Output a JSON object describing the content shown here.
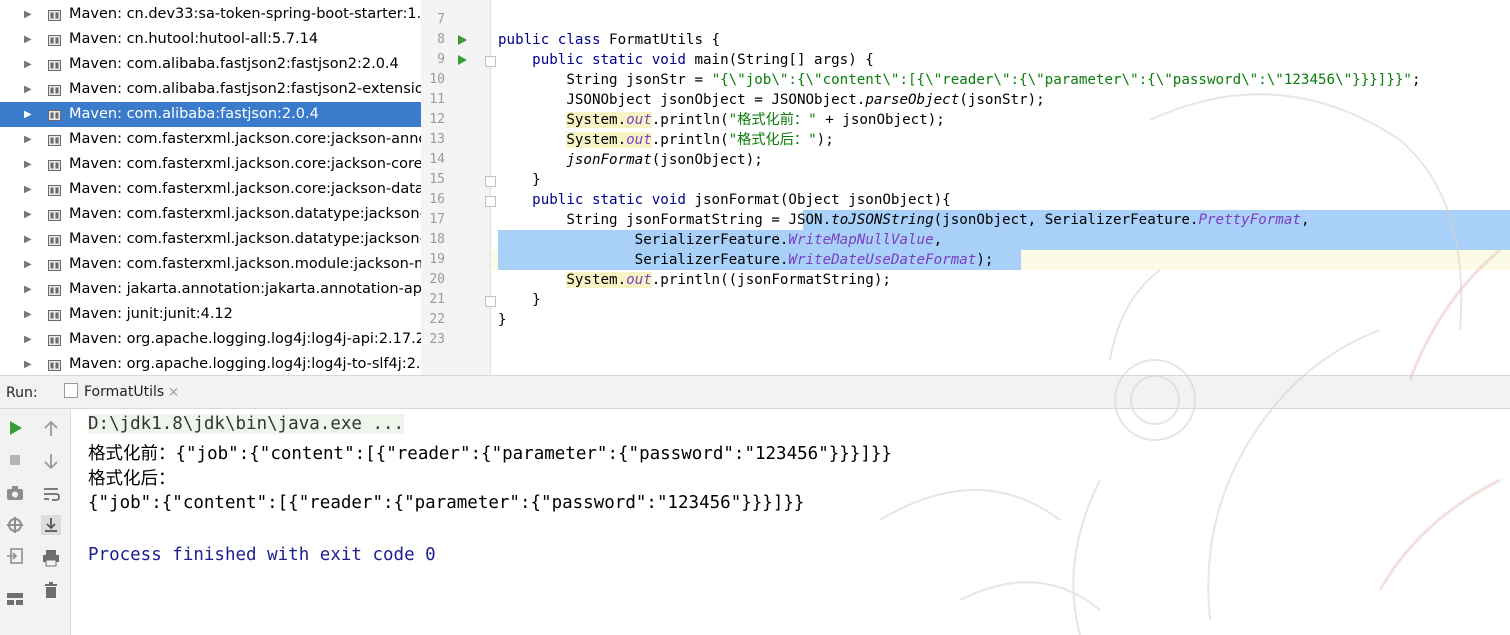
{
  "project_tree": {
    "items": [
      {
        "label": "Maven: cn.dev33:sa-token-spring-boot-starter:1.",
        "selected": false
      },
      {
        "label": "Maven: cn.hutool:hutool-all:5.7.14",
        "selected": false
      },
      {
        "label": "Maven: com.alibaba.fastjson2:fastjson2:2.0.4",
        "selected": false
      },
      {
        "label": "Maven: com.alibaba.fastjson2:fastjson2-extensio",
        "selected": false
      },
      {
        "label": "Maven: com.alibaba:fastjson:2.0.4",
        "selected": true
      },
      {
        "label": "Maven: com.fasterxml.jackson.core:jackson-anno",
        "selected": false
      },
      {
        "label": "Maven: com.fasterxml.jackson.core:jackson-core",
        "selected": false
      },
      {
        "label": "Maven: com.fasterxml.jackson.core:jackson-data",
        "selected": false
      },
      {
        "label": "Maven: com.fasterxml.jackson.datatype:jackson-",
        "selected": false
      },
      {
        "label": "Maven: com.fasterxml.jackson.datatype:jackson-",
        "selected": false
      },
      {
        "label": "Maven: com.fasterxml.jackson.module:jackson-m",
        "selected": false
      },
      {
        "label": "Maven: jakarta.annotation:jakarta.annotation-api",
        "selected": false
      },
      {
        "label": "Maven: junit:junit:4.12",
        "selected": false
      },
      {
        "label": "Maven: org.apache.logging.log4j:log4j-api:2.17.2",
        "selected": false
      },
      {
        "label": "Maven: org.apache.logging.log4j:log4j-to-slf4j:2.",
        "selected": false
      }
    ]
  },
  "editor": {
    "line_numbers": [
      "7",
      "8",
      "9",
      "10",
      "11",
      "12",
      "13",
      "14",
      "15",
      "16",
      "17",
      "18",
      "19",
      "20",
      "21",
      "22",
      "23"
    ],
    "tokens": {
      "l8_kw": "public class ",
      "l8_rest": "FormatUtils {",
      "l9_kw1": "public static void ",
      "l9_rest": "main(String[] args) {",
      "l10_a": "String jsonStr = ",
      "l10_str": "\"{\\\"job\\\":{\\\"content\\\":[{\\\"reader\\\":{\\\"parameter\\\":{\\\"password\\\":\\\"123456\\\"}}}]}}\"",
      "l10_end": ";",
      "l11_a": "JSONObject jsonObject = JSONObject.",
      "l11_m": "parseObject",
      "l11_b": "(jsonStr);",
      "sys": "System.",
      "out": "out",
      "println_open": ".println(",
      "l12_str": "\"格式化前：\"",
      "l12_b": " + jsonObject);",
      "l13_str": "\"格式化后：\"",
      "l13_b": ");",
      "l14_m": "jsonFormat",
      "l14_b": "(jsonObject);",
      "close_brace": "}",
      "l16_kw": "public static void ",
      "l16_rest": "jsonFormat(Object jsonObject){",
      "l17_a": "String jsonFormatString = ",
      "l17_b": "JSON.",
      "l17_m": "toJSONString",
      "l17_c": "(jsonObject, SerializerFeature.",
      "l17_f": "PrettyFormat",
      "l17_d": ",",
      "feature_prefix": "SerializerFeature.",
      "l18_f": "WriteMapNullValue",
      "l18_d": ",",
      "l19_f": "WriteDateUseDateFormat",
      "l19_d": ");",
      "l20_b": "(jsonFormatString);"
    }
  },
  "run_panel": {
    "title": "Run:",
    "tab_label": "FormatUtils",
    "tab_close": "×"
  },
  "console": {
    "lines": [
      "D:\\jdk1.8\\jdk\\bin\\java.exe ...",
      "格式化前：{\"job\":{\"content\":[{\"reader\":{\"parameter\":{\"password\":\"123456\"}}}]}}",
      "格式化后：",
      "{\"job\":{\"content\":[{\"reader\":{\"parameter\":{\"password\":\"123456\"}}}]}}",
      "",
      "Process finished with exit code 0"
    ]
  },
  "colors": {
    "selection": "#3a7ccb",
    "keyword": "#00008b",
    "string": "#0a7d0a",
    "field": "#7b3fbf",
    "exit_text": "#1e2090"
  }
}
